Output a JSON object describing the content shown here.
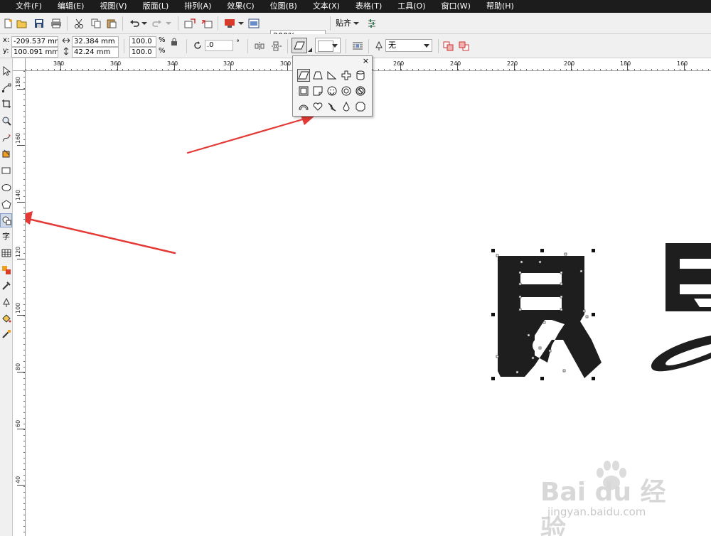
{
  "menu": [
    "文件(F)",
    "编辑(E)",
    "视图(V)",
    "版面(L)",
    "排列(A)",
    "效果(C)",
    "位图(B)",
    "文本(X)",
    "表格(T)",
    "工具(O)",
    "窗口(W)",
    "帮助(H)"
  ],
  "toolbar": {
    "zoom_value": "200%",
    "snap_label": "贴齐"
  },
  "property_bar": {
    "x_label": "x:",
    "y_label": "y:",
    "x_value": "-209.537 mm",
    "y_value": "100.091 mm",
    "width_value": "32.384 mm",
    "height_value": "42.24 mm",
    "scale_x": "100.0",
    "scale_y": "100.0",
    "percent": "%",
    "rotation_value": ".0",
    "degree": "°",
    "outline_value": "无"
  },
  "ruler_h_labels": [
    "380",
    "360",
    "340",
    "320",
    "300",
    "260",
    "240",
    "220",
    "200",
    "180",
    "160"
  ],
  "ruler_v_labels": [
    "180",
    "160",
    "140",
    "120",
    "100",
    "80",
    "60",
    "40"
  ],
  "toolbox_text_tool": "字",
  "flyout": {
    "close": "×",
    "icons": [
      "parallelogram-icon",
      "trapezoid-icon",
      "right-triangle-icon",
      "cross-icon",
      "cylinder-icon",
      "frame-icon",
      "folded-corner-icon",
      "smiley-icon",
      "donut-icon",
      "no-sign-icon",
      "arc-icon",
      "heart-icon",
      "lightning-icon",
      "drop-icon",
      "octagon-icon"
    ]
  },
  "watermark": {
    "logo": "Bai du 经验",
    "url": "jingyan.baidu.com"
  },
  "colors": {
    "menubar": "#1c1c1c",
    "arrow": "#e53935",
    "glyph": "#1e1e1e"
  }
}
